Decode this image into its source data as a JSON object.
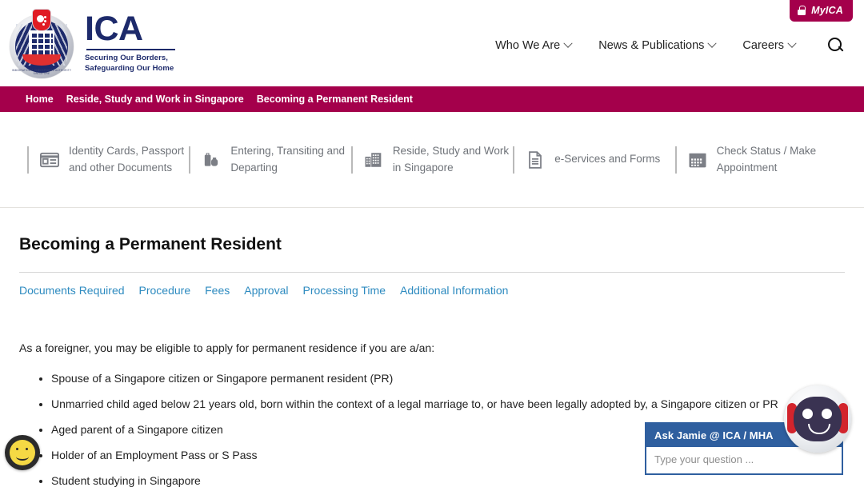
{
  "header": {
    "logo": {
      "wordmark": "ICA",
      "tagline_line1": "Securing Our Borders,",
      "tagline_line2": "Safeguarding Our Home",
      "crest_text_line1": "IMMIGRATION & CHECKPOINTS AUTHORITY",
      "crest_text_line2": "SINGAPORE"
    },
    "nav": [
      {
        "label": "Who We Are",
        "has_dropdown": true
      },
      {
        "label": "News & Publications",
        "has_dropdown": true
      },
      {
        "label": "Careers",
        "has_dropdown": true
      }
    ],
    "search_icon": "search-icon",
    "myica": {
      "label": "MyICA",
      "icon": "lock-icon",
      "color": "#a4004b"
    }
  },
  "breadcrumb": {
    "background": "#a4004b",
    "items": [
      "Home",
      "Reside, Study and Work in Singapore",
      "Becoming a Permanent Resident"
    ]
  },
  "icon_nav": {
    "items": [
      {
        "icon": "id-card-icon",
        "label": "Identity Cards, Passport and other Documents"
      },
      {
        "icon": "luggage-icon",
        "label": "Entering, Transiting and Departing"
      },
      {
        "icon": "building-icon",
        "label": "Reside, Study and Work in Singapore"
      },
      {
        "icon": "document-icon",
        "label": "e-Services and Forms"
      },
      {
        "icon": "calendar-icon",
        "label": "Check Status / Make Appointment"
      }
    ]
  },
  "main": {
    "title": "Becoming a Permanent Resident",
    "link_color": "#2e8bc0",
    "quick_links": [
      "Documents Required",
      "Procedure",
      "Fees",
      "Approval",
      "Processing Time",
      "Additional Information"
    ],
    "intro": "As a foreigner, you may be eligible to apply for permanent residence if you are a/an:",
    "eligibility": [
      "Spouse of a Singapore citizen or Singapore permanent resident (PR)",
      "Unmarried child aged below 21 years old, born within the context of a legal marriage to, or have been legally adopted by, a Singapore citizen or PR",
      "Aged parent of a Singapore citizen",
      "Holder of an Employment Pass or S Pass",
      "Student studying in Singapore"
    ]
  },
  "feedback": {
    "icon": "smiley-face-icon",
    "color": "#f5d944"
  },
  "chatbot": {
    "title": "Ask Jamie @ ICA / MHA",
    "input_placeholder": "Type your question ...",
    "input_value": "",
    "header_color": "#2f5f9f",
    "avatar_icon": "robot-avatar-icon"
  }
}
